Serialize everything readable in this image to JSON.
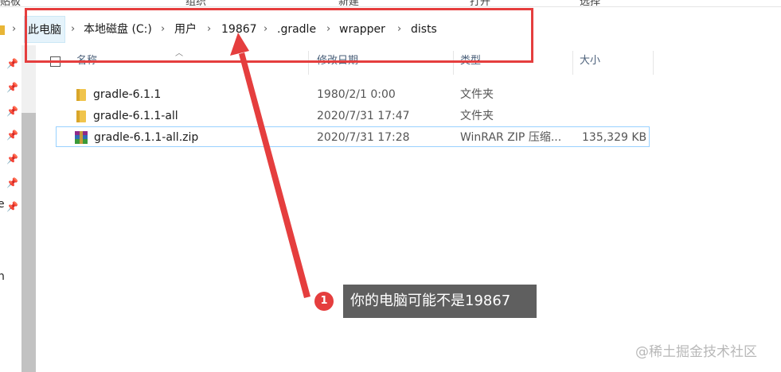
{
  "ribbon": {
    "labels": [
      "贴板",
      "组织",
      "新建",
      "打开",
      "选择"
    ]
  },
  "breadcrumb": {
    "segments": [
      "此电脑",
      "本地磁盘 (C:)",
      "用户",
      "19867",
      ".gradle",
      "wrapper",
      "dists"
    ]
  },
  "left_nav": {
    "edge_text_1": "e",
    "edge_text_2": "n"
  },
  "columns": {
    "name": "名称",
    "modified": "修改日期",
    "type": "类型",
    "size": "大小"
  },
  "files": [
    {
      "name": "gradle-6.1.1",
      "modified": "1980/2/1 0:00",
      "type": "文件夹",
      "size": "",
      "icon": "folder-icon"
    },
    {
      "name": "gradle-6.1.1-all",
      "modified": "2020/7/31 17:47",
      "type": "文件夹",
      "size": "",
      "icon": "folder-icon"
    },
    {
      "name": "gradle-6.1.1-all.zip",
      "modified": "2020/7/31 17:28",
      "type": "WinRAR ZIP 压缩...",
      "size": "135,329 KB",
      "icon": "winrar-zip-icon"
    }
  ],
  "annotation": {
    "step_number": "1",
    "tooltip_text": "你的电脑可能不是19867",
    "accent_color": "#e53e3e"
  },
  "watermark": "@稀土掘金技术社区"
}
